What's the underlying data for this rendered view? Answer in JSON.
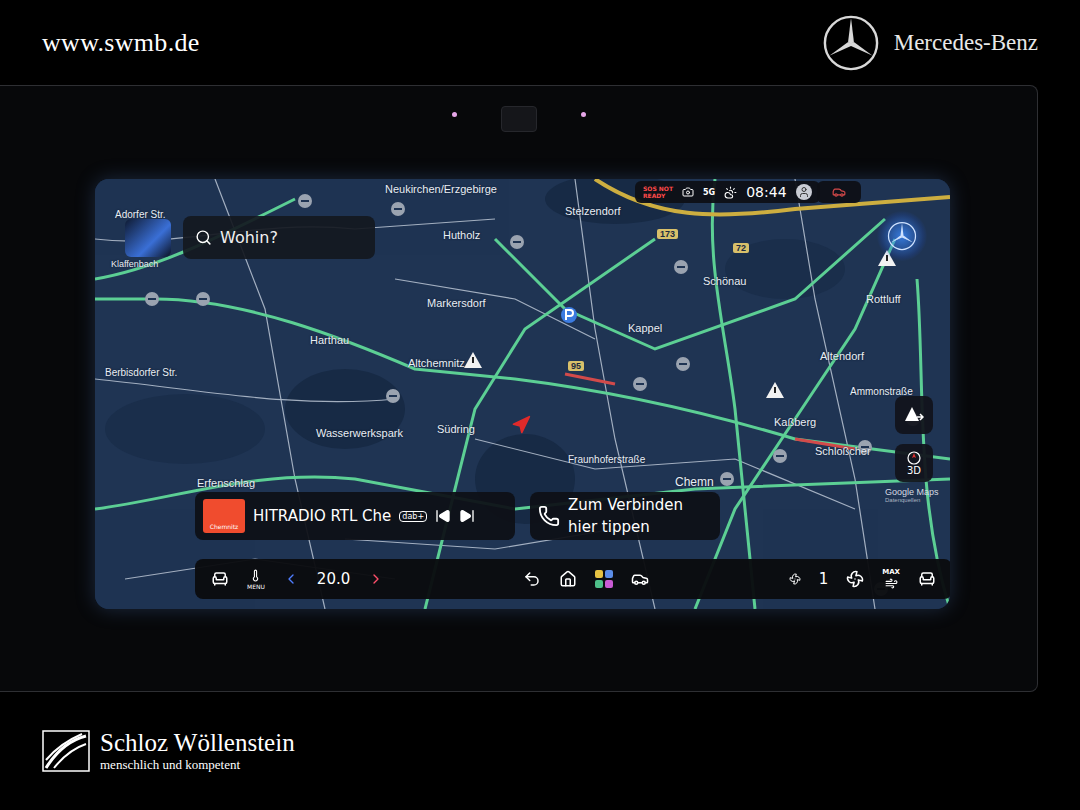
{
  "header": {
    "url": "www.swmb.de",
    "brand": "Mercedes-Benz"
  },
  "screen": {
    "search": {
      "placeholder": "Wohin?"
    },
    "status": {
      "sos_lines": [
        "SOS NOT",
        "READY"
      ],
      "network": "5G",
      "time": "08:44"
    },
    "map": {
      "places": [
        "Adorfer Str.",
        "Klaffenbach",
        "Neukirchen/Erzgebirge",
        "Hutholz",
        "Stelzendorf",
        "Schönau",
        "Rottluff",
        "Markersdorf",
        "Kappel",
        "Harthau",
        "Altchemnitz",
        "Altendorf",
        "Berbisdorfer Str.",
        "Ammonstraße",
        "Kaßberg",
        "Wasserwerkspark",
        "Südring",
        "Fraunhoferstraße",
        "Schloßcher",
        "Chemn",
        "Erfenschlag"
      ],
      "road_numbers": [
        "173",
        "72",
        "95"
      ],
      "attribution": [
        "Google Maps",
        "Datenquellen"
      ]
    },
    "view_button": "3D",
    "media": {
      "station": "HITRADIO RTL Che",
      "logo_text": "Chemnitz",
      "badge": "dab+"
    },
    "phone": {
      "lines": [
        "Zum Verbinden",
        "hier tippen"
      ]
    },
    "climate": {
      "menu": "MENU",
      "temperature": "20.0",
      "fan": "1",
      "max": "MAX"
    }
  },
  "dealer": {
    "name": "Schloz Wöllenstein",
    "tagline": "menschlich und kompetent"
  }
}
